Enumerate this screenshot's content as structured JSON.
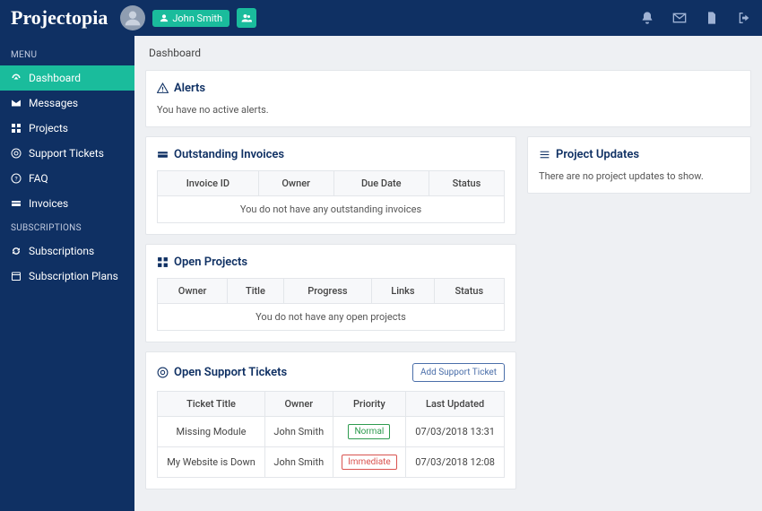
{
  "brand": "Projectopia",
  "user": {
    "name": "John Smith"
  },
  "sidebar": {
    "heading1": "MENU",
    "heading2": "SUBSCRIPTIONS",
    "items": [
      {
        "label": "Dashboard"
      },
      {
        "label": "Messages"
      },
      {
        "label": "Projects"
      },
      {
        "label": "Support Tickets"
      },
      {
        "label": "FAQ"
      },
      {
        "label": "Invoices"
      }
    ],
    "subs": [
      {
        "label": "Subscriptions"
      },
      {
        "label": "Subscription Plans"
      }
    ]
  },
  "page": {
    "title": "Dashboard"
  },
  "alerts": {
    "title": "Alerts",
    "empty": "You have no active alerts."
  },
  "invoices": {
    "title": "Outstanding Invoices",
    "cols": {
      "c0": "Invoice ID",
      "c1": "Owner",
      "c2": "Due Date",
      "c3": "Status"
    },
    "empty": "You do not have any outstanding invoices"
  },
  "projects_panel": {
    "title": "Open Projects",
    "cols": {
      "c0": "Owner",
      "c1": "Title",
      "c2": "Progress",
      "c3": "Links",
      "c4": "Status"
    },
    "empty": "You do not have any open projects"
  },
  "tickets": {
    "title": "Open Support Tickets",
    "button": "Add Support Ticket",
    "cols": {
      "c0": "Ticket Title",
      "c1": "Owner",
      "c2": "Priority",
      "c3": "Last Updated"
    },
    "rows": [
      {
        "title": "Missing Module",
        "owner": "John Smith",
        "priority": "Normal",
        "priority_class": "pill-normal",
        "updated": "07/03/2018 13:31"
      },
      {
        "title": "My Website is Down",
        "owner": "John Smith",
        "priority": "Immediate",
        "priority_class": "pill-immediate",
        "updated": "07/03/2018 12:08"
      }
    ]
  },
  "updates": {
    "title": "Project Updates",
    "empty": "There are no project updates to show."
  }
}
